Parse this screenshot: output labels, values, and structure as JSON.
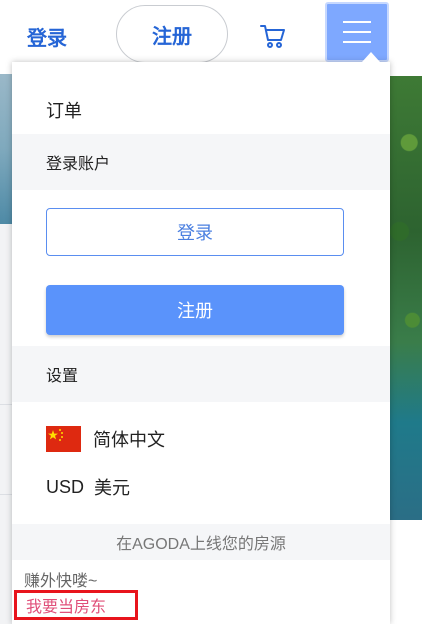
{
  "header": {
    "login_label": "登录",
    "register_label": "注册",
    "cart_icon": "cart-icon",
    "menu_icon": "hamburger-menu-icon"
  },
  "menu": {
    "orders_label": "订单",
    "account_section_title": "登录账户",
    "login_button": "登录",
    "register_button": "注册",
    "settings_section_title": "设置",
    "language": {
      "flag": "china-flag-icon",
      "label": "简体中文"
    },
    "currency": {
      "code": "USD",
      "name": "美元"
    },
    "list_property_label": "在AGODA上线您的房源",
    "earn_text": "赚外快喽~",
    "become_host_label": "我要当房东"
  },
  "colors": {
    "brand_blue": "#2565d6",
    "menu_button": "#7ea8ff",
    "register_button": "#5a93fb",
    "highlight_border": "#e8141c",
    "host_link": "#e0507a"
  }
}
